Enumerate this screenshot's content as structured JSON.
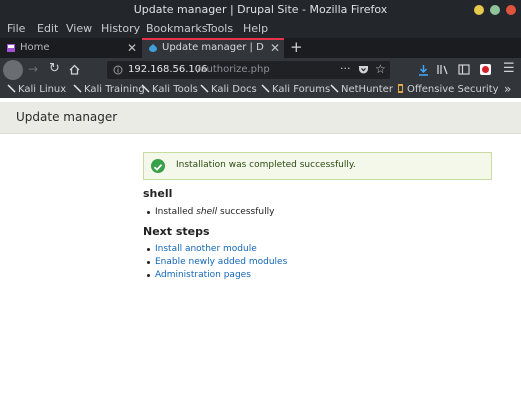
{
  "window": {
    "title": "Update manager | Drupal Site - Mozilla Firefox"
  },
  "menu": [
    "File",
    "Edit",
    "View",
    "History",
    "Bookmarks",
    "Tools",
    "Help"
  ],
  "tabs": [
    {
      "label": "Home",
      "active": false
    },
    {
      "label": "Update manager | Drupal",
      "active": true
    }
  ],
  "address": {
    "host": "192.168.56.106",
    "path": "/authorize.php"
  },
  "bookmarks": [
    "Kali Linux",
    "Kali Training",
    "Kali Tools",
    "Kali Docs",
    "Kali Forums",
    "NetHunter",
    "Offensive Security"
  ],
  "page": {
    "title": "Update manager",
    "status_message": "Installation was completed successfully.",
    "module_heading": "shell",
    "installed_prefix": "Installed ",
    "installed_name": "shell",
    "installed_suffix": " successfully",
    "next_steps_heading": "Next steps",
    "next_links": [
      "Install another module",
      "Enable newly added modules",
      "Administration pages"
    ]
  },
  "colors": {
    "accent": "#39a04a",
    "link": "#1366b6",
    "tab_active": "#e8334a"
  }
}
